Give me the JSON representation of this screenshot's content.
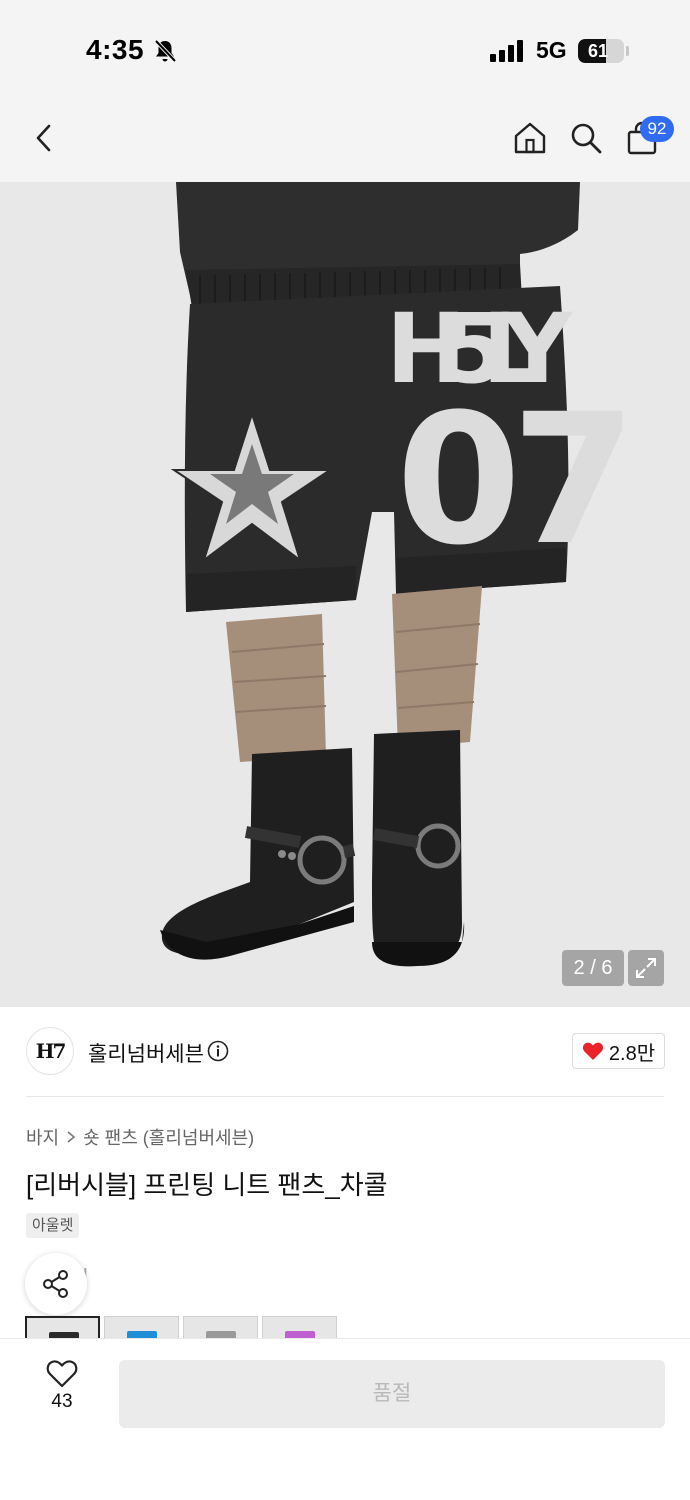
{
  "status_bar": {
    "time": "4:35",
    "network": "5G",
    "battery_level": "61",
    "battery_fraction": 0.61,
    "icons": [
      "bell-slash-icon",
      "signal-icon",
      "battery-icon"
    ]
  },
  "header": {
    "icons": [
      "chevron-left-icon",
      "home-icon",
      "search-icon",
      "shopping-bag-icon"
    ],
    "cart_count": "92"
  },
  "gallery": {
    "counter": "2 / 6",
    "current": 2,
    "total": 6,
    "print_letters": "H5LY",
    "print_number": "07",
    "icons": [
      "expand-icon"
    ]
  },
  "brand": {
    "logo_text": "H7",
    "name": "홀리넘버세븐",
    "likes": "2.8만",
    "icons": [
      "info-icon",
      "heart-filled-icon"
    ],
    "accent": "#e8232a"
  },
  "product": {
    "breadcrumb": [
      "바지",
      "숏 팬츠 (홀리넘버세븐)"
    ],
    "title": "[리버시블] 프린팅 니트 팬츠_차콜",
    "tag": "아울렛",
    "price_fragment": "il"
  },
  "thumbnails": [
    {
      "color": "#2b2b2b",
      "selected": true
    },
    {
      "color": "#1e8fd6",
      "selected": false
    },
    {
      "color": "#9a9a9a",
      "selected": false
    },
    {
      "color": "#c05fd0",
      "selected": false
    }
  ],
  "bottom_bar": {
    "wish_count": "43",
    "cta_label": "품절",
    "icons": [
      "heart-outline-icon"
    ]
  }
}
